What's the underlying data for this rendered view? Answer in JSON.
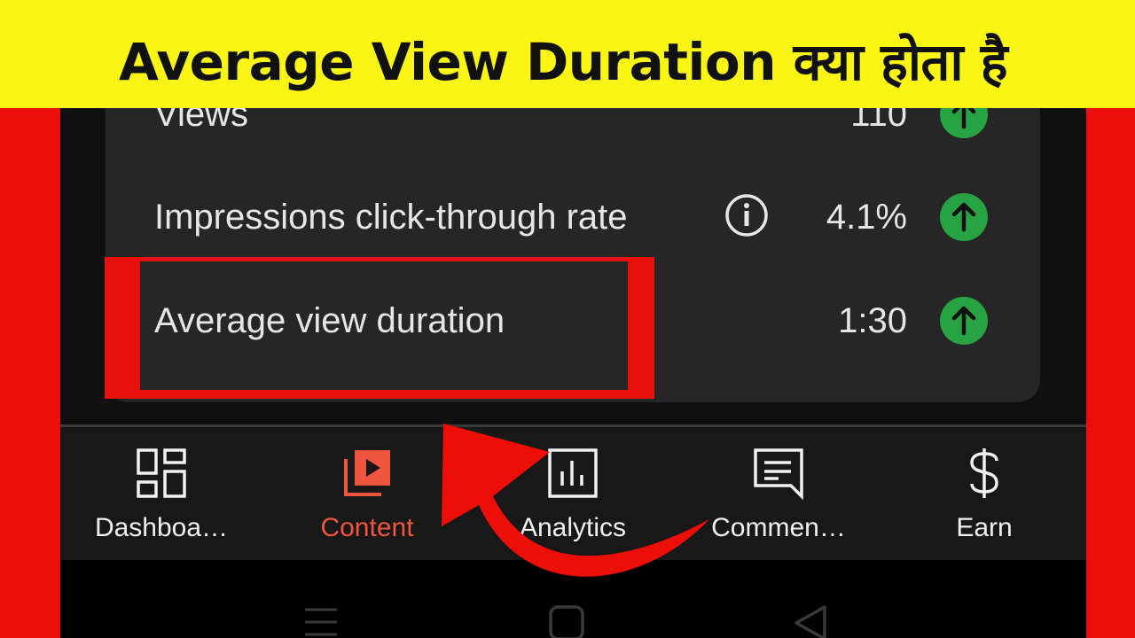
{
  "banner": {
    "title": "Average View Duration क्या होता है"
  },
  "metrics": [
    {
      "label": "Views",
      "value": "110",
      "trend_icon": "arrow-up-circle-icon",
      "has_info": false
    },
    {
      "label": "Impressions click-through rate",
      "value": "4.1%",
      "trend_icon": "arrow-up-circle-icon",
      "has_info": true
    },
    {
      "label": "Average view duration",
      "value": "1:30",
      "trend_icon": "arrow-up-circle-icon",
      "has_info": false
    }
  ],
  "nav": {
    "items": [
      {
        "label": "Dashboa…",
        "icon": "dashboard-icon",
        "active": false
      },
      {
        "label": "Content",
        "icon": "content-icon",
        "active": true
      },
      {
        "label": "Analytics",
        "icon": "analytics-icon",
        "active": false
      },
      {
        "label": "Commen…",
        "icon": "comments-icon",
        "active": false
      },
      {
        "label": "Earn",
        "icon": "dollar-icon",
        "active": false
      }
    ]
  },
  "colors": {
    "banner_bg": "#fbf515",
    "frame_bg": "#ee0e08",
    "card_bg": "#262626",
    "trend_up": "#27a343",
    "active_nav": "#f0553f",
    "highlight": "#e8100c"
  }
}
